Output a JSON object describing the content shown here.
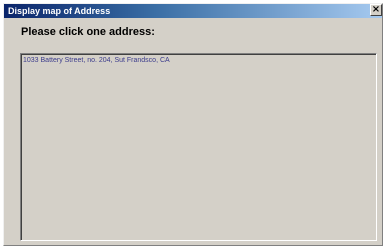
{
  "window": {
    "title": "Display map of Address",
    "close_label": "×"
  },
  "dialog": {
    "prompt": "Please click one address:"
  },
  "address_list": {
    "items": [
      {
        "label": "1033 Battery Street, no. 204, Sut Frandsco, CA"
      }
    ]
  }
}
